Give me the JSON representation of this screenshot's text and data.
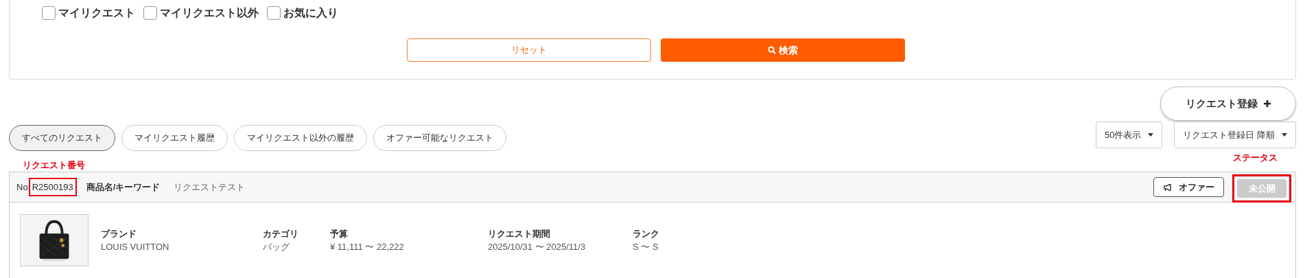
{
  "filters": {
    "checkboxes": [
      {
        "label": "マイリクエスト",
        "checked": false
      },
      {
        "label": "マイリクエスト以外",
        "checked": false
      },
      {
        "label": "お気に入り",
        "checked": false
      }
    ],
    "reset_button": "リセット",
    "search_button": "検索"
  },
  "register_button": "リクエスト登録",
  "tabs": [
    {
      "label": "すべてのリクエスト",
      "selected": true
    },
    {
      "label": "マイリクエスト履歴",
      "selected": false
    },
    {
      "label": "マイリクエスト以外の履歴",
      "selected": false
    },
    {
      "label": "オファー可能なリクエスト",
      "selected": false
    }
  ],
  "dropdowns": [
    "50件表示",
    "リクエスト登録日 降順"
  ],
  "annotations": {
    "request_number": "リクエスト番号",
    "status": "ステータス"
  },
  "request": {
    "no_label": "No",
    "number": "R2500193",
    "keyword_label": "商品名/キーワード",
    "keyword": "リクエストテスト",
    "offer_button": "オファー",
    "status": "未公開",
    "fields": [
      {
        "label": "ブランド",
        "value": "LOUIS VUITTON"
      },
      {
        "label": "カテゴリ",
        "value": "バッグ"
      },
      {
        "label": "予算",
        "value": "¥ 11,111 〜 22,222"
      },
      {
        "label": "リクエスト期間",
        "value": "2025/10/31 〜 2025/11/3"
      },
      {
        "label": "ランク",
        "value": "S 〜 S"
      }
    ]
  }
}
